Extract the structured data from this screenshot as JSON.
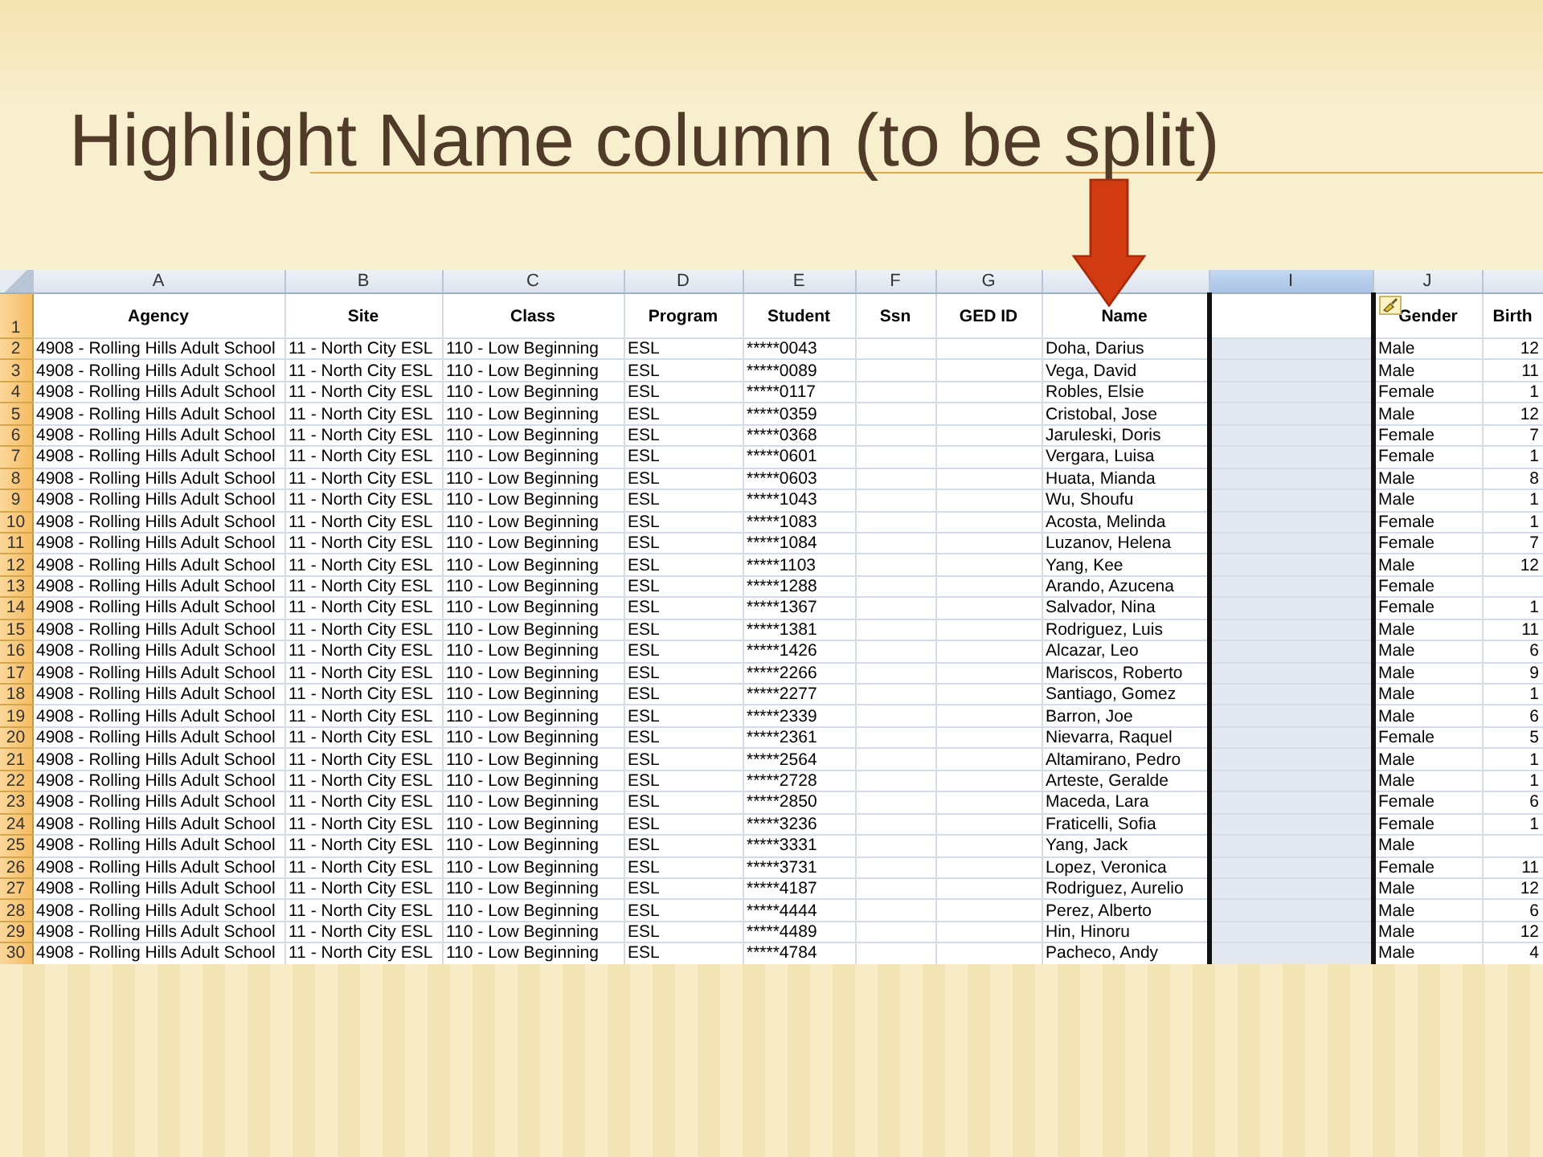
{
  "slide": {
    "title": "Highlight Name column (to be split)"
  },
  "sheet": {
    "columns": [
      {
        "letter": "A",
        "heading": "Agency",
        "selected": false
      },
      {
        "letter": "B",
        "heading": "Site",
        "selected": false
      },
      {
        "letter": "C",
        "heading": "Class",
        "selected": false
      },
      {
        "letter": "D",
        "heading": "Program",
        "selected": false
      },
      {
        "letter": "E",
        "heading": "Student",
        "selected": false
      },
      {
        "letter": "F",
        "heading": "Ssn",
        "selected": false
      },
      {
        "letter": "G",
        "heading": "GED ID",
        "selected": false
      },
      {
        "heading": "Name",
        "selected": false
      },
      {
        "letter": "I",
        "selected": true
      },
      {
        "letter": "J",
        "heading": "Gender",
        "selected": false
      },
      {
        "heading": "Birth",
        "selected": false
      }
    ],
    "header_row": "1",
    "rows": [
      {
        "number": "2",
        "cells": [
          "4908 - Rolling Hills Adult School",
          "11 - North City ESL",
          "110 - Low Beginning",
          "ESL",
          "*****0043",
          null,
          null,
          "Doha, Darius",
          null,
          "Male",
          "12"
        ]
      },
      {
        "number": "3",
        "cells": [
          "4908 - Rolling Hills Adult School",
          "11 - North City ESL",
          "110 - Low Beginning",
          "ESL",
          "*****0089",
          null,
          null,
          "Vega, David",
          null,
          "Male",
          "11"
        ]
      },
      {
        "number": "4",
        "cells": [
          "4908 - Rolling Hills Adult School",
          "11 - North City ESL",
          "110 - Low Beginning",
          "ESL",
          "*****0117",
          null,
          null,
          "Robles, Elsie",
          null,
          "Female",
          "1"
        ]
      },
      {
        "number": "5",
        "cells": [
          "4908 - Rolling Hills Adult School",
          "11 - North City ESL",
          "110 - Low Beginning",
          "ESL",
          "*****0359",
          null,
          null,
          "Cristobal, Jose",
          null,
          "Male",
          "12"
        ]
      },
      {
        "number": "6",
        "cells": [
          "4908 - Rolling Hills Adult School",
          "11 - North City ESL",
          "110 - Low Beginning",
          "ESL",
          "*****0368",
          null,
          null,
          "Jaruleski, Doris",
          null,
          "Female",
          "7"
        ]
      },
      {
        "number": "7",
        "cells": [
          "4908 - Rolling Hills Adult School",
          "11 - North City ESL",
          "110 - Low Beginning",
          "ESL",
          "*****0601",
          null,
          null,
          "Vergara, Luisa",
          null,
          "Female",
          "1"
        ]
      },
      {
        "number": "8",
        "cells": [
          "4908 - Rolling Hills Adult School",
          "11 - North City ESL",
          "110 - Low Beginning",
          "ESL",
          "*****0603",
          null,
          null,
          "Huata, Mianda",
          null,
          "Male",
          "8"
        ]
      },
      {
        "number": "9",
        "cells": [
          "4908 - Rolling Hills Adult School",
          "11 - North City ESL",
          "110 - Low Beginning",
          "ESL",
          "*****1043",
          null,
          null,
          "Wu, Shoufu",
          null,
          "Male",
          "1"
        ]
      },
      {
        "number": "10",
        "cells": [
          "4908 - Rolling Hills Adult School",
          "11 - North City ESL",
          "110 - Low Beginning",
          "ESL",
          "*****1083",
          null,
          null,
          "Acosta, Melinda",
          null,
          "Female",
          "1"
        ]
      },
      {
        "number": "11",
        "cells": [
          "4908 - Rolling Hills Adult School",
          "11 - North City ESL",
          "110 - Low Beginning",
          "ESL",
          "*****1084",
          null,
          null,
          "Luzanov, Helena",
          null,
          "Female",
          "7"
        ]
      },
      {
        "number": "12",
        "cells": [
          "4908 - Rolling Hills Adult School",
          "11 - North City ESL",
          "110 - Low Beginning",
          "ESL",
          "*****1103",
          null,
          null,
          "Yang, Kee",
          null,
          "Male",
          "12"
        ]
      },
      {
        "number": "13",
        "cells": [
          "4908 - Rolling Hills Adult School",
          "11 - North City ESL",
          "110 - Low Beginning",
          "ESL",
          "*****1288",
          null,
          null,
          "Arando, Azucena",
          null,
          "Female",
          null
        ]
      },
      {
        "number": "14",
        "cells": [
          "4908 - Rolling Hills Adult School",
          "11 - North City ESL",
          "110 - Low Beginning",
          "ESL",
          "*****1367",
          null,
          null,
          "Salvador, Nina",
          null,
          "Female",
          "1"
        ]
      },
      {
        "number": "15",
        "cells": [
          "4908 - Rolling Hills Adult School",
          "11 - North City ESL",
          "110 - Low Beginning",
          "ESL",
          "*****1381",
          null,
          null,
          "Rodriguez, Luis",
          null,
          "Male",
          "11"
        ]
      },
      {
        "number": "16",
        "cells": [
          "4908 - Rolling Hills Adult School",
          "11 - North City ESL",
          "110 - Low Beginning",
          "ESL",
          "*****1426",
          null,
          null,
          "Alcazar, Leo",
          null,
          "Male",
          "6"
        ]
      },
      {
        "number": "17",
        "cells": [
          "4908 - Rolling Hills Adult School",
          "11 - North City ESL",
          "110 - Low Beginning",
          "ESL",
          "*****2266",
          null,
          null,
          "Mariscos, Roberto",
          null,
          "Male",
          "9"
        ]
      },
      {
        "number": "18",
        "cells": [
          "4908 - Rolling Hills Adult School",
          "11 - North City ESL",
          "110 - Low Beginning",
          "ESL",
          "*****2277",
          null,
          null,
          "Santiago, Gomez",
          null,
          "Male",
          "1"
        ]
      },
      {
        "number": "19",
        "cells": [
          "4908 - Rolling Hills Adult School",
          "11 - North City ESL",
          "110 - Low Beginning",
          "ESL",
          "*****2339",
          null,
          null,
          "Barron, Joe",
          null,
          "Male",
          "6"
        ]
      },
      {
        "number": "20",
        "cells": [
          "4908 - Rolling Hills Adult School",
          "11 - North City ESL",
          "110 - Low Beginning",
          "ESL",
          "*****2361",
          null,
          null,
          "Nievarra, Raquel",
          null,
          "Female",
          "5"
        ]
      },
      {
        "number": "21",
        "cells": [
          "4908 - Rolling Hills Adult School",
          "11 - North City ESL",
          "110 - Low Beginning",
          "ESL",
          "*****2564",
          null,
          null,
          "Altamirano, Pedro",
          null,
          "Male",
          "1"
        ]
      },
      {
        "number": "22",
        "cells": [
          "4908 - Rolling Hills Adult School",
          "11 - North City ESL",
          "110 - Low Beginning",
          "ESL",
          "*****2728",
          null,
          null,
          "Arteste, Geralde",
          null,
          "Male",
          "1"
        ]
      },
      {
        "number": "23",
        "cells": [
          "4908 - Rolling Hills Adult School",
          "11 - North City ESL",
          "110 - Low Beginning",
          "ESL",
          "*****2850",
          null,
          null,
          "Maceda, Lara",
          null,
          "Female",
          "6"
        ]
      },
      {
        "number": "24",
        "cells": [
          "4908 - Rolling Hills Adult School",
          "11 - North City ESL",
          "110 - Low Beginning",
          "ESL",
          "*****3236",
          null,
          null,
          "Fraticelli, Sofia",
          null,
          "Female",
          "1"
        ]
      },
      {
        "number": "25",
        "cells": [
          "4908 - Rolling Hills Adult School",
          "11 - North City ESL",
          "110 - Low Beginning",
          "ESL",
          "*****3331",
          null,
          null,
          "Yang, Jack",
          null,
          "Male",
          null
        ]
      },
      {
        "number": "26",
        "cells": [
          "4908 - Rolling Hills Adult School",
          "11 - North City ESL",
          "110 - Low Beginning",
          "ESL",
          "*****3731",
          null,
          null,
          "Lopez, Veronica",
          null,
          "Female",
          "11"
        ]
      },
      {
        "number": "27",
        "cells": [
          "4908 - Rolling Hills Adult School",
          "11 - North City ESL",
          "110 - Low Beginning",
          "ESL",
          "*****4187",
          null,
          null,
          "Rodriguez, Aurelio",
          null,
          "Male",
          "12"
        ]
      },
      {
        "number": "28",
        "cells": [
          "4908 - Rolling Hills Adult School",
          "11 - North City ESL",
          "110 - Low Beginning",
          "ESL",
          "*****4444",
          null,
          null,
          "Perez, Alberto",
          null,
          "Male",
          "6"
        ]
      },
      {
        "number": "29",
        "cells": [
          "4908 - Rolling Hills Adult School",
          "11 - North City ESL",
          "110 - Low Beginning",
          "ESL",
          "*****4489",
          null,
          null,
          "Hin, Hinoru",
          null,
          "Male",
          "12"
        ]
      },
      {
        "number": "30",
        "cells": [
          "4908 - Rolling Hills Adult School",
          "11 - North City ESL",
          "110 - Low Beginning",
          "ESL",
          "*****4784",
          null,
          null,
          "Pacheco, Andy",
          null,
          "Male",
          "4"
        ]
      }
    ]
  }
}
